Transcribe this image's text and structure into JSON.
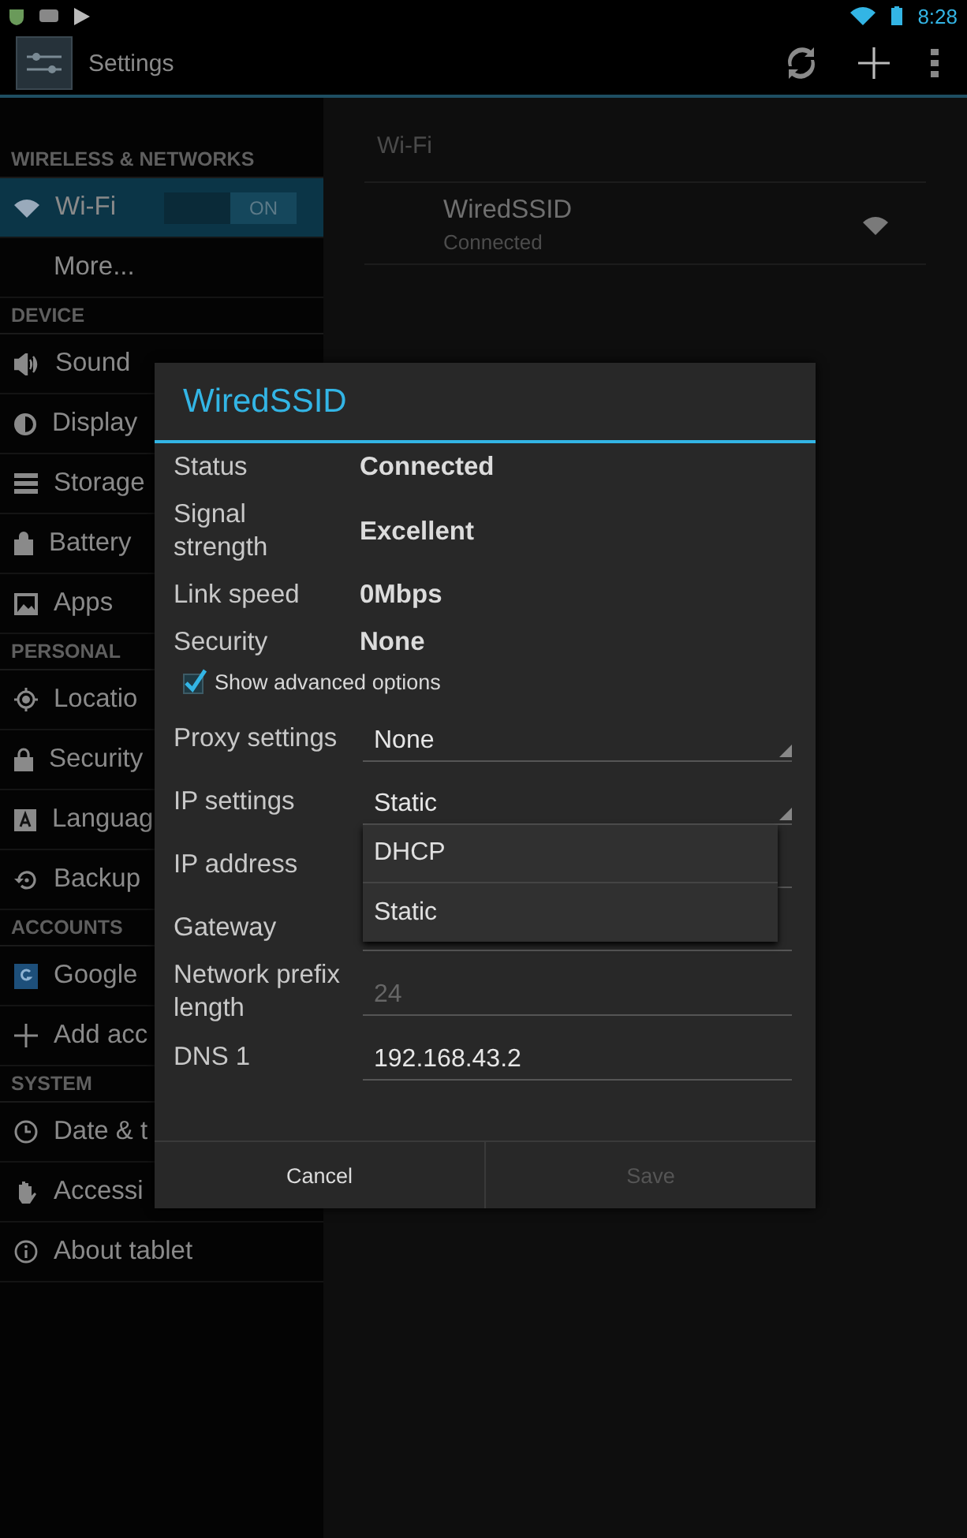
{
  "status_bar": {
    "time": "8:28"
  },
  "action_bar": {
    "title": "Settings"
  },
  "sidebar": {
    "sections": [
      {
        "header": "WIRELESS & NETWORKS",
        "items": [
          {
            "label": "Wi-Fi",
            "selected": true,
            "toggle": {
              "label": "ON",
              "on": true
            }
          },
          {
            "label": "More...",
            "selected": false
          }
        ]
      },
      {
        "header": "DEVICE",
        "items": [
          {
            "label": "Sound",
            "selected": false
          },
          {
            "label": "Display",
            "selected": false
          },
          {
            "label": "Storage",
            "selected": false
          },
          {
            "label": "Battery",
            "selected": false
          },
          {
            "label": "Apps",
            "selected": false
          }
        ]
      },
      {
        "header": "PERSONAL",
        "items": [
          {
            "label": "Locatio",
            "selected": false
          },
          {
            "label": "Security",
            "selected": false
          },
          {
            "label": "Languag",
            "selected": false
          },
          {
            "label": "Backup",
            "selected": false
          }
        ]
      },
      {
        "header": "ACCOUNTS",
        "items": [
          {
            "label": "Google",
            "selected": false
          },
          {
            "label": "Add acc",
            "selected": false
          }
        ]
      },
      {
        "header": "SYSTEM",
        "items": [
          {
            "label": "Date & t",
            "selected": false
          },
          {
            "label": "Accessi",
            "selected": false
          },
          {
            "label": "About tablet",
            "selected": false
          }
        ]
      }
    ]
  },
  "pane": {
    "title": "Wi-Fi",
    "networks": [
      {
        "name": "WiredSSID",
        "status": "Connected"
      }
    ]
  },
  "dialog": {
    "title": "WiredSSID",
    "info": [
      {
        "label": "Status",
        "value": "Connected"
      },
      {
        "label": "Signal strength",
        "value": "Excellent"
      },
      {
        "label": "Link speed",
        "value": "0Mbps"
      },
      {
        "label": "Security",
        "value": "None"
      }
    ],
    "advanced": {
      "label": "Show advanced options",
      "checked": true
    },
    "fields": [
      {
        "label": "Proxy settings",
        "kind": "spinner",
        "value": "None"
      },
      {
        "label": "IP settings",
        "kind": "spinner",
        "value": "Static"
      },
      {
        "label": "IP address",
        "kind": "text"
      },
      {
        "label": "Gateway",
        "kind": "text"
      },
      {
        "label": "Network prefix length",
        "kind": "text",
        "placeholder": "24"
      },
      {
        "label": "DNS 1",
        "kind": "text",
        "value": "192.168.43.2"
      }
    ],
    "dropdown": {
      "options": [
        "DHCP",
        "Static"
      ]
    },
    "buttons": [
      {
        "label": "Cancel",
        "disabled": false
      },
      {
        "label": "Save",
        "disabled": true
      }
    ]
  }
}
